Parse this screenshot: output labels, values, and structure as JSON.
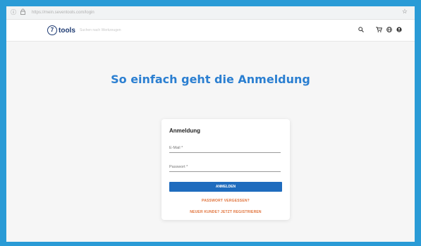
{
  "browser": {
    "url": "https://mein.seventools.com/login",
    "info_icon": "info-icon",
    "lock_icon": "lock-icon",
    "bookmark_icon": "star-icon"
  },
  "header": {
    "logo_number": "7",
    "logo_text": "tools",
    "search_placeholder": "Suchen nach Werkzeugen",
    "icons": [
      "search-icon",
      "cart-icon",
      "globe-icon",
      "user-icon"
    ]
  },
  "main": {
    "heading": "So einfach geht die Anmeldung"
  },
  "login": {
    "title": "Anmeldung",
    "email_label": "E-Mail *",
    "password_label": "Passwort *",
    "submit_label": "ANMELDEN",
    "forgot_label": "PASSWORT VERGESSEN?",
    "register_label": "NEUER KUNDE? JETZT REGISTRIEREN"
  },
  "colors": {
    "accent_blue": "#2b7fd1",
    "button_blue": "#1f6cbe",
    "link_orange": "#e0723a",
    "brand_navy": "#1d3a72"
  }
}
